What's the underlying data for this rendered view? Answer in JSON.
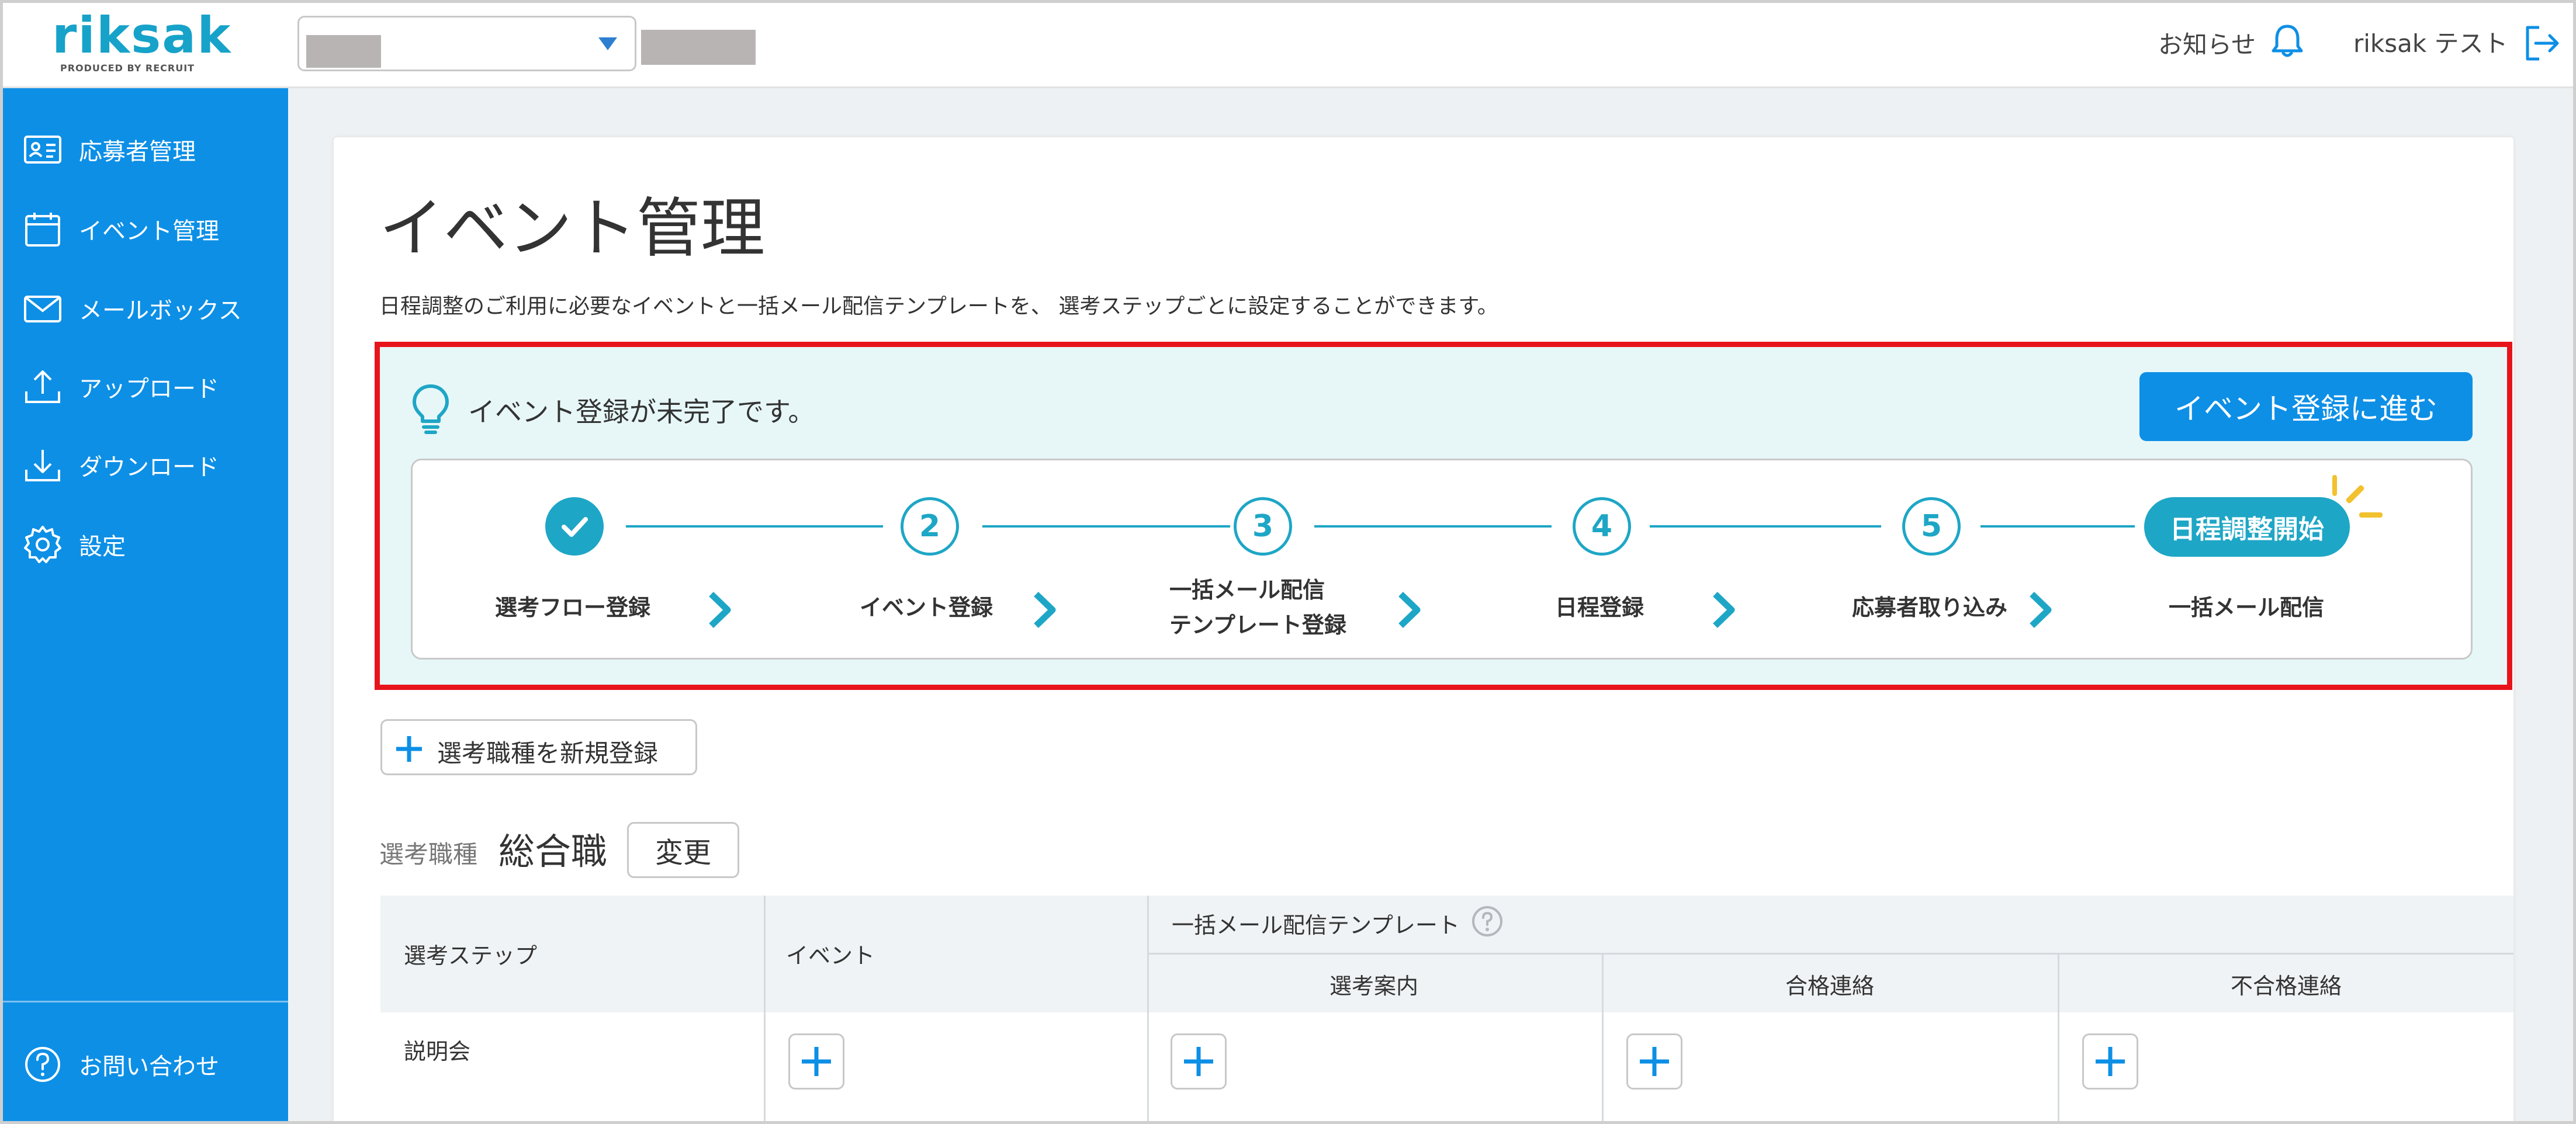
{
  "header": {
    "logo_text": "riksak",
    "logo_sub": "PRODUCED BY RECRUIT",
    "notice_label": "お知らせ",
    "user_name": "riksak テスト"
  },
  "sidebar": {
    "items": [
      {
        "label": "応募者管理",
        "icon": "applicant-card-icon"
      },
      {
        "label": "イベント管理",
        "icon": "calendar-icon"
      },
      {
        "label": "メールボックス",
        "icon": "mail-icon"
      },
      {
        "label": "アップロード",
        "icon": "upload-icon"
      },
      {
        "label": "ダウンロード",
        "icon": "download-icon"
      },
      {
        "label": "設定",
        "icon": "gear-icon"
      }
    ],
    "contact_label": "お問い合わせ"
  },
  "main": {
    "title": "イベント管理",
    "description": "日程調整のご利用に必要なイベントと一括メール配信テンプレートを、 選考ステップごとに設定することができます。"
  },
  "alert": {
    "message": "イベント登録が未完了です。",
    "button_label": "イベント登録に進む",
    "steps": [
      {
        "marker": "done",
        "label_line1": "選考フロー登録",
        "label_line2": ""
      },
      {
        "marker": "2",
        "label_line1": "イベント登録",
        "label_line2": ""
      },
      {
        "marker": "3",
        "label_line1": "一括メール配信",
        "label_line2": "テンプレート登録"
      },
      {
        "marker": "4",
        "label_line1": "日程登録",
        "label_line2": ""
      },
      {
        "marker": "5",
        "label_line1": "応募者取り込み",
        "label_line2": ""
      },
      {
        "marker": "日程調整開始",
        "label_line1": "一括メール配信",
        "label_line2": ""
      }
    ]
  },
  "new_job_button": "選考職種を新規登録",
  "job": {
    "label": "選考職種",
    "value": "総合職",
    "change_label": "変更"
  },
  "table": {
    "col_step": "選考ステップ",
    "col_event": "イベント",
    "col_template_group": "一括メール配信テンプレート",
    "col_guide": "選考案内",
    "col_pass": "合格連絡",
    "col_fail": "不合格連絡",
    "rows": [
      {
        "step": "説明会"
      }
    ]
  },
  "colors": {
    "primary": "#0d8fe6",
    "accent": "#1ea6c6",
    "highlight_border": "#e8141b",
    "alert_bg": "#e7f7f8"
  }
}
